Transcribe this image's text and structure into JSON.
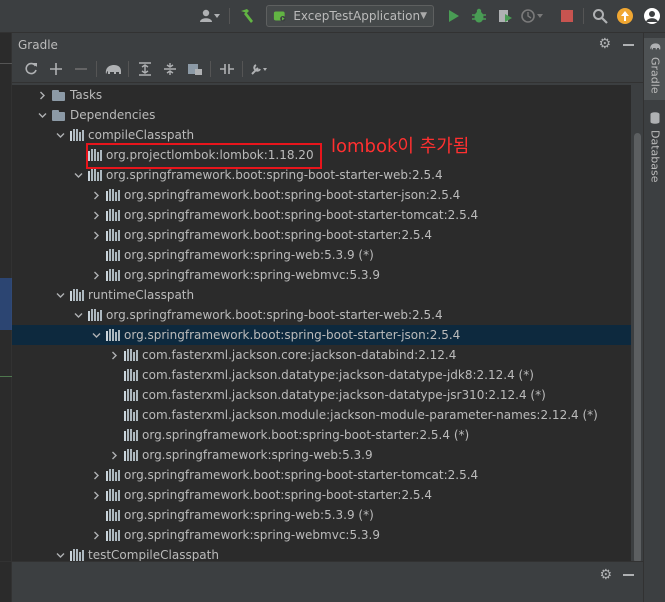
{
  "toolbar": {
    "run_config": "ExcepTestApplication",
    "icons": [
      "user-icon",
      "hammer-icon",
      "run-icon",
      "debug-icon",
      "coverage-icon",
      "profile-icon",
      "stop-icon",
      "search-icon",
      "update-icon"
    ]
  },
  "panel": {
    "title": "Gradle",
    "tools": [
      "refresh-icon",
      "add-icon",
      "remove-icon",
      "elephant-icon",
      "expand-all-icon",
      "collapse-all-icon",
      "group-modules-icon",
      "toggle-offline-icon",
      "settings-wrench-icon"
    ]
  },
  "tree": {
    "rows": [
      {
        "label": "Tasks",
        "indent": 1,
        "arrow": "collapsed",
        "icon": "folder"
      },
      {
        "label": "Dependencies",
        "indent": 1,
        "arrow": "expanded",
        "icon": "folder"
      },
      {
        "label": "compileClasspath",
        "indent": 2,
        "arrow": "expanded",
        "icon": "bars"
      },
      {
        "label": "org.projectlombok:lombok:1.18.20",
        "indent": 3,
        "arrow": "none",
        "icon": "bars"
      },
      {
        "label": "org.springframework.boot:spring-boot-starter-web:2.5.4",
        "indent": 3,
        "arrow": "expanded",
        "icon": "bars"
      },
      {
        "label": "org.springframework.boot:spring-boot-starter-json:2.5.4",
        "indent": 4,
        "arrow": "collapsed",
        "icon": "bars"
      },
      {
        "label": "org.springframework.boot:spring-boot-starter-tomcat:2.5.4",
        "indent": 4,
        "arrow": "collapsed",
        "icon": "bars"
      },
      {
        "label": "org.springframework.boot:spring-boot-starter:2.5.4",
        "indent": 4,
        "arrow": "collapsed",
        "icon": "bars"
      },
      {
        "label": "org.springframework:spring-web:5.3.9 (*)",
        "indent": 4,
        "arrow": "none",
        "icon": "bars"
      },
      {
        "label": "org.springframework:spring-webmvc:5.3.9",
        "indent": 4,
        "arrow": "collapsed",
        "icon": "bars"
      },
      {
        "label": "runtimeClasspath",
        "indent": 2,
        "arrow": "expanded",
        "icon": "bars"
      },
      {
        "label": "org.springframework.boot:spring-boot-starter-web:2.5.4",
        "indent": 3,
        "arrow": "expanded",
        "icon": "bars"
      },
      {
        "label": "org.springframework.boot:spring-boot-starter-json:2.5.4",
        "indent": 4,
        "arrow": "expanded",
        "icon": "bars",
        "selected": true
      },
      {
        "label": "com.fasterxml.jackson.core:jackson-databind:2.12.4",
        "indent": 5,
        "arrow": "collapsed",
        "icon": "bars"
      },
      {
        "label": "com.fasterxml.jackson.datatype:jackson-datatype-jdk8:2.12.4 (*)",
        "indent": 5,
        "arrow": "none",
        "icon": "bars"
      },
      {
        "label": "com.fasterxml.jackson.datatype:jackson-datatype-jsr310:2.12.4 (*)",
        "indent": 5,
        "arrow": "none",
        "icon": "bars"
      },
      {
        "label": "com.fasterxml.jackson.module:jackson-module-parameter-names:2.12.4 (*)",
        "indent": 5,
        "arrow": "none",
        "icon": "bars"
      },
      {
        "label": "org.springframework.boot:spring-boot-starter:2.5.4 (*)",
        "indent": 5,
        "arrow": "none",
        "icon": "bars"
      },
      {
        "label": "org.springframework:spring-web:5.3.9",
        "indent": 5,
        "arrow": "collapsed",
        "icon": "bars"
      },
      {
        "label": "org.springframework.boot:spring-boot-starter-tomcat:2.5.4",
        "indent": 4,
        "arrow": "collapsed",
        "icon": "bars"
      },
      {
        "label": "org.springframework.boot:spring-boot-starter:2.5.4",
        "indent": 4,
        "arrow": "collapsed",
        "icon": "bars"
      },
      {
        "label": "org.springframework:spring-web:5.3.9 (*)",
        "indent": 4,
        "arrow": "none",
        "icon": "bars"
      },
      {
        "label": "org.springframework:spring-webmvc:5.3.9",
        "indent": 4,
        "arrow": "collapsed",
        "icon": "bars"
      },
      {
        "label": "testCompileClasspath",
        "indent": 2,
        "arrow": "expanded",
        "icon": "bars"
      }
    ]
  },
  "side_tabs": {
    "gradle": "Gradle",
    "database": "Database"
  },
  "annotation": {
    "text": "lombok이 추가됨",
    "color": "#e8151c"
  },
  "colors": {
    "selection": "#0d293e",
    "run_green": "#499c54",
    "stop_red": "#c75450",
    "update_orange": "#f0a732"
  }
}
